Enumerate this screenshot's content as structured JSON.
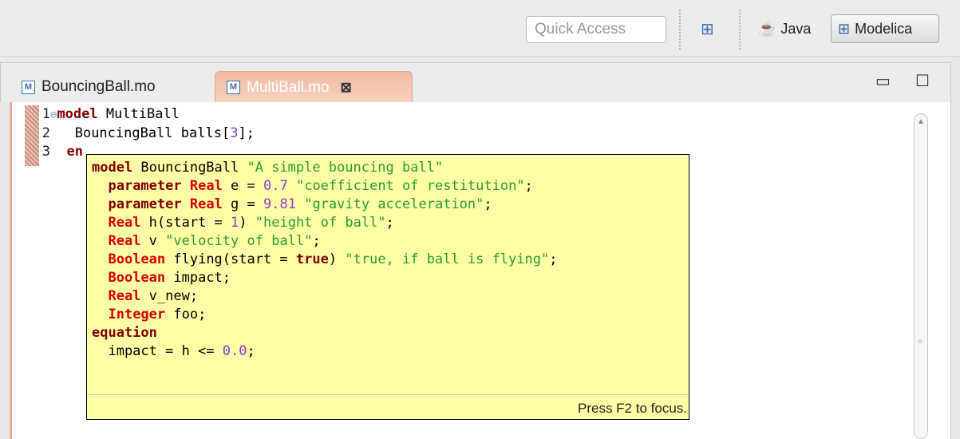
{
  "toolbar": {
    "quick_access_placeholder": "Quick Access",
    "perspectives": [
      {
        "label": "Java",
        "active": false,
        "icon": "java-perspective-icon"
      },
      {
        "label": "Modelica",
        "active": true,
        "icon": "modelica-perspective-icon"
      }
    ]
  },
  "tabs": [
    {
      "label": "BouncingBall.mo",
      "active": false
    },
    {
      "label": "MultiBall.mo",
      "active": true
    }
  ],
  "editor": {
    "lines": [
      {
        "num": "1",
        "keyword": "model",
        "text": " MultiBall"
      },
      {
        "num": "2",
        "text_before": "  BouncingBall balls[",
        "number": "3",
        "text_after": "];"
      },
      {
        "num": "3",
        "keyword": "en",
        "text": ""
      }
    ]
  },
  "popup": {
    "lines": [
      [
        {
          "t": "kw",
          "v": "model"
        },
        {
          "t": "plain",
          "v": " BouncingBall "
        },
        {
          "t": "str",
          "v": "\"A simple bouncing ball\""
        }
      ],
      [
        {
          "t": "plain",
          "v": "  "
        },
        {
          "t": "kw",
          "v": "parameter"
        },
        {
          "t": "plain",
          "v": " "
        },
        {
          "t": "type",
          "v": "Real"
        },
        {
          "t": "plain",
          "v": " e = "
        },
        {
          "t": "num",
          "v": "0.7"
        },
        {
          "t": "plain",
          "v": " "
        },
        {
          "t": "str",
          "v": "\"coefficient of restitution\""
        },
        {
          "t": "plain",
          "v": ";"
        }
      ],
      [
        {
          "t": "plain",
          "v": "  "
        },
        {
          "t": "kw",
          "v": "parameter"
        },
        {
          "t": "plain",
          "v": " "
        },
        {
          "t": "type",
          "v": "Real"
        },
        {
          "t": "plain",
          "v": " g = "
        },
        {
          "t": "num",
          "v": "9.81"
        },
        {
          "t": "plain",
          "v": " "
        },
        {
          "t": "str",
          "v": "\"gravity acceleration\""
        },
        {
          "t": "plain",
          "v": ";"
        }
      ],
      [
        {
          "t": "plain",
          "v": "  "
        },
        {
          "t": "type",
          "v": "Real"
        },
        {
          "t": "plain",
          "v": " h(start = "
        },
        {
          "t": "num",
          "v": "1"
        },
        {
          "t": "plain",
          "v": ") "
        },
        {
          "t": "str",
          "v": "\"height of ball\""
        },
        {
          "t": "plain",
          "v": ";"
        }
      ],
      [
        {
          "t": "plain",
          "v": "  "
        },
        {
          "t": "type",
          "v": "Real"
        },
        {
          "t": "plain",
          "v": " v "
        },
        {
          "t": "str",
          "v": "\"velocity of ball\""
        },
        {
          "t": "plain",
          "v": ";"
        }
      ],
      [
        {
          "t": "plain",
          "v": "  "
        },
        {
          "t": "type",
          "v": "Boolean"
        },
        {
          "t": "plain",
          "v": " flying(start = "
        },
        {
          "t": "kw",
          "v": "true"
        },
        {
          "t": "plain",
          "v": ") "
        },
        {
          "t": "str",
          "v": "\"true, if ball is flying\""
        },
        {
          "t": "plain",
          "v": ";"
        }
      ],
      [
        {
          "t": "plain",
          "v": "  "
        },
        {
          "t": "type",
          "v": "Boolean"
        },
        {
          "t": "plain",
          "v": " impact;"
        }
      ],
      [
        {
          "t": "plain",
          "v": "  "
        },
        {
          "t": "type",
          "v": "Real"
        },
        {
          "t": "plain",
          "v": " v_new;"
        }
      ],
      [
        {
          "t": "plain",
          "v": "  "
        },
        {
          "t": "type",
          "v": "Integer"
        },
        {
          "t": "plain",
          "v": " foo;"
        }
      ],
      [
        {
          "t": "kw",
          "v": "equation"
        }
      ],
      [
        {
          "t": "plain",
          "v": "  impact = h <= "
        },
        {
          "t": "num",
          "v": "0.0"
        },
        {
          "t": "plain",
          "v": ";"
        }
      ]
    ],
    "hint": "Press F2 to focus."
  },
  "colors": {
    "keyword": "#7f0000",
    "type": "#d80000",
    "string": "#2b9e24",
    "number": "#8c3bd0",
    "popup_bg": "#ffffa8",
    "active_tab": "#f2b9a0"
  }
}
